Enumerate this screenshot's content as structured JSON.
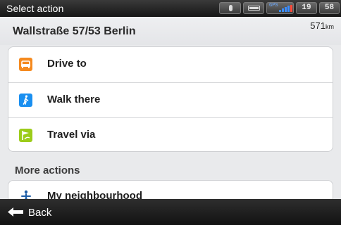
{
  "status_bar": {
    "title": "Select action",
    "clock_hours": "19",
    "clock_minutes": "58",
    "gps_label": "GPS",
    "icons": [
      "microphone-icon",
      "battery-icon",
      "gps-signal-icon"
    ]
  },
  "header": {
    "address": "Wallstraße 57/53  Berlin",
    "distance_value": "571",
    "distance_unit": "km"
  },
  "actions": [
    {
      "label": "Drive to",
      "icon": "car-icon",
      "color": "#f58a1f"
    },
    {
      "label": "Walk there",
      "icon": "pedestrian-icon",
      "color": "#1a8ff0"
    },
    {
      "label": "Travel via",
      "icon": "travel-via-flag-icon",
      "color": "#9ccc1a"
    }
  ],
  "more_actions": {
    "title": "More actions",
    "items": [
      {
        "label": "My neighbourhood",
        "icon": "neighbourhood-icon"
      }
    ]
  },
  "bottom_bar": {
    "back_label": "Back",
    "icon": "back-arrow-icon"
  }
}
